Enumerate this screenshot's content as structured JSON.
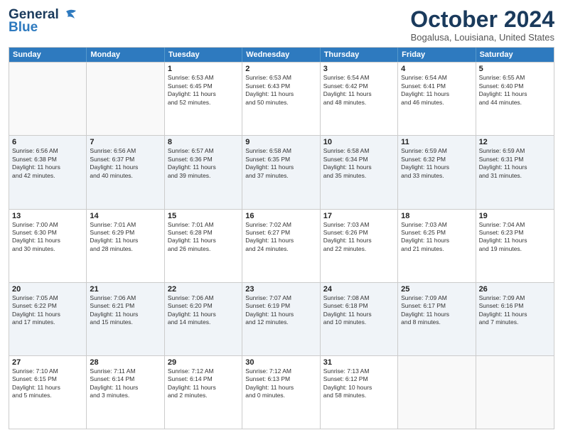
{
  "header": {
    "logo_line1": "General",
    "logo_line2": "Blue",
    "month_title": "October 2024",
    "location": "Bogalusa, Louisiana, United States"
  },
  "day_headers": [
    "Sunday",
    "Monday",
    "Tuesday",
    "Wednesday",
    "Thursday",
    "Friday",
    "Saturday"
  ],
  "weeks": [
    [
      {
        "num": "",
        "info": ""
      },
      {
        "num": "",
        "info": ""
      },
      {
        "num": "1",
        "info": "Sunrise: 6:53 AM\nSunset: 6:45 PM\nDaylight: 11 hours\nand 52 minutes."
      },
      {
        "num": "2",
        "info": "Sunrise: 6:53 AM\nSunset: 6:43 PM\nDaylight: 11 hours\nand 50 minutes."
      },
      {
        "num": "3",
        "info": "Sunrise: 6:54 AM\nSunset: 6:42 PM\nDaylight: 11 hours\nand 48 minutes."
      },
      {
        "num": "4",
        "info": "Sunrise: 6:54 AM\nSunset: 6:41 PM\nDaylight: 11 hours\nand 46 minutes."
      },
      {
        "num": "5",
        "info": "Sunrise: 6:55 AM\nSunset: 6:40 PM\nDaylight: 11 hours\nand 44 minutes."
      }
    ],
    [
      {
        "num": "6",
        "info": "Sunrise: 6:56 AM\nSunset: 6:38 PM\nDaylight: 11 hours\nand 42 minutes."
      },
      {
        "num": "7",
        "info": "Sunrise: 6:56 AM\nSunset: 6:37 PM\nDaylight: 11 hours\nand 40 minutes."
      },
      {
        "num": "8",
        "info": "Sunrise: 6:57 AM\nSunset: 6:36 PM\nDaylight: 11 hours\nand 39 minutes."
      },
      {
        "num": "9",
        "info": "Sunrise: 6:58 AM\nSunset: 6:35 PM\nDaylight: 11 hours\nand 37 minutes."
      },
      {
        "num": "10",
        "info": "Sunrise: 6:58 AM\nSunset: 6:34 PM\nDaylight: 11 hours\nand 35 minutes."
      },
      {
        "num": "11",
        "info": "Sunrise: 6:59 AM\nSunset: 6:32 PM\nDaylight: 11 hours\nand 33 minutes."
      },
      {
        "num": "12",
        "info": "Sunrise: 6:59 AM\nSunset: 6:31 PM\nDaylight: 11 hours\nand 31 minutes."
      }
    ],
    [
      {
        "num": "13",
        "info": "Sunrise: 7:00 AM\nSunset: 6:30 PM\nDaylight: 11 hours\nand 30 minutes."
      },
      {
        "num": "14",
        "info": "Sunrise: 7:01 AM\nSunset: 6:29 PM\nDaylight: 11 hours\nand 28 minutes."
      },
      {
        "num": "15",
        "info": "Sunrise: 7:01 AM\nSunset: 6:28 PM\nDaylight: 11 hours\nand 26 minutes."
      },
      {
        "num": "16",
        "info": "Sunrise: 7:02 AM\nSunset: 6:27 PM\nDaylight: 11 hours\nand 24 minutes."
      },
      {
        "num": "17",
        "info": "Sunrise: 7:03 AM\nSunset: 6:26 PM\nDaylight: 11 hours\nand 22 minutes."
      },
      {
        "num": "18",
        "info": "Sunrise: 7:03 AM\nSunset: 6:25 PM\nDaylight: 11 hours\nand 21 minutes."
      },
      {
        "num": "19",
        "info": "Sunrise: 7:04 AM\nSunset: 6:23 PM\nDaylight: 11 hours\nand 19 minutes."
      }
    ],
    [
      {
        "num": "20",
        "info": "Sunrise: 7:05 AM\nSunset: 6:22 PM\nDaylight: 11 hours\nand 17 minutes."
      },
      {
        "num": "21",
        "info": "Sunrise: 7:06 AM\nSunset: 6:21 PM\nDaylight: 11 hours\nand 15 minutes."
      },
      {
        "num": "22",
        "info": "Sunrise: 7:06 AM\nSunset: 6:20 PM\nDaylight: 11 hours\nand 14 minutes."
      },
      {
        "num": "23",
        "info": "Sunrise: 7:07 AM\nSunset: 6:19 PM\nDaylight: 11 hours\nand 12 minutes."
      },
      {
        "num": "24",
        "info": "Sunrise: 7:08 AM\nSunset: 6:18 PM\nDaylight: 11 hours\nand 10 minutes."
      },
      {
        "num": "25",
        "info": "Sunrise: 7:09 AM\nSunset: 6:17 PM\nDaylight: 11 hours\nand 8 minutes."
      },
      {
        "num": "26",
        "info": "Sunrise: 7:09 AM\nSunset: 6:16 PM\nDaylight: 11 hours\nand 7 minutes."
      }
    ],
    [
      {
        "num": "27",
        "info": "Sunrise: 7:10 AM\nSunset: 6:15 PM\nDaylight: 11 hours\nand 5 minutes."
      },
      {
        "num": "28",
        "info": "Sunrise: 7:11 AM\nSunset: 6:14 PM\nDaylight: 11 hours\nand 3 minutes."
      },
      {
        "num": "29",
        "info": "Sunrise: 7:12 AM\nSunset: 6:14 PM\nDaylight: 11 hours\nand 2 minutes."
      },
      {
        "num": "30",
        "info": "Sunrise: 7:12 AM\nSunset: 6:13 PM\nDaylight: 11 hours\nand 0 minutes."
      },
      {
        "num": "31",
        "info": "Sunrise: 7:13 AM\nSunset: 6:12 PM\nDaylight: 10 hours\nand 58 minutes."
      },
      {
        "num": "",
        "info": ""
      },
      {
        "num": "",
        "info": ""
      }
    ]
  ]
}
